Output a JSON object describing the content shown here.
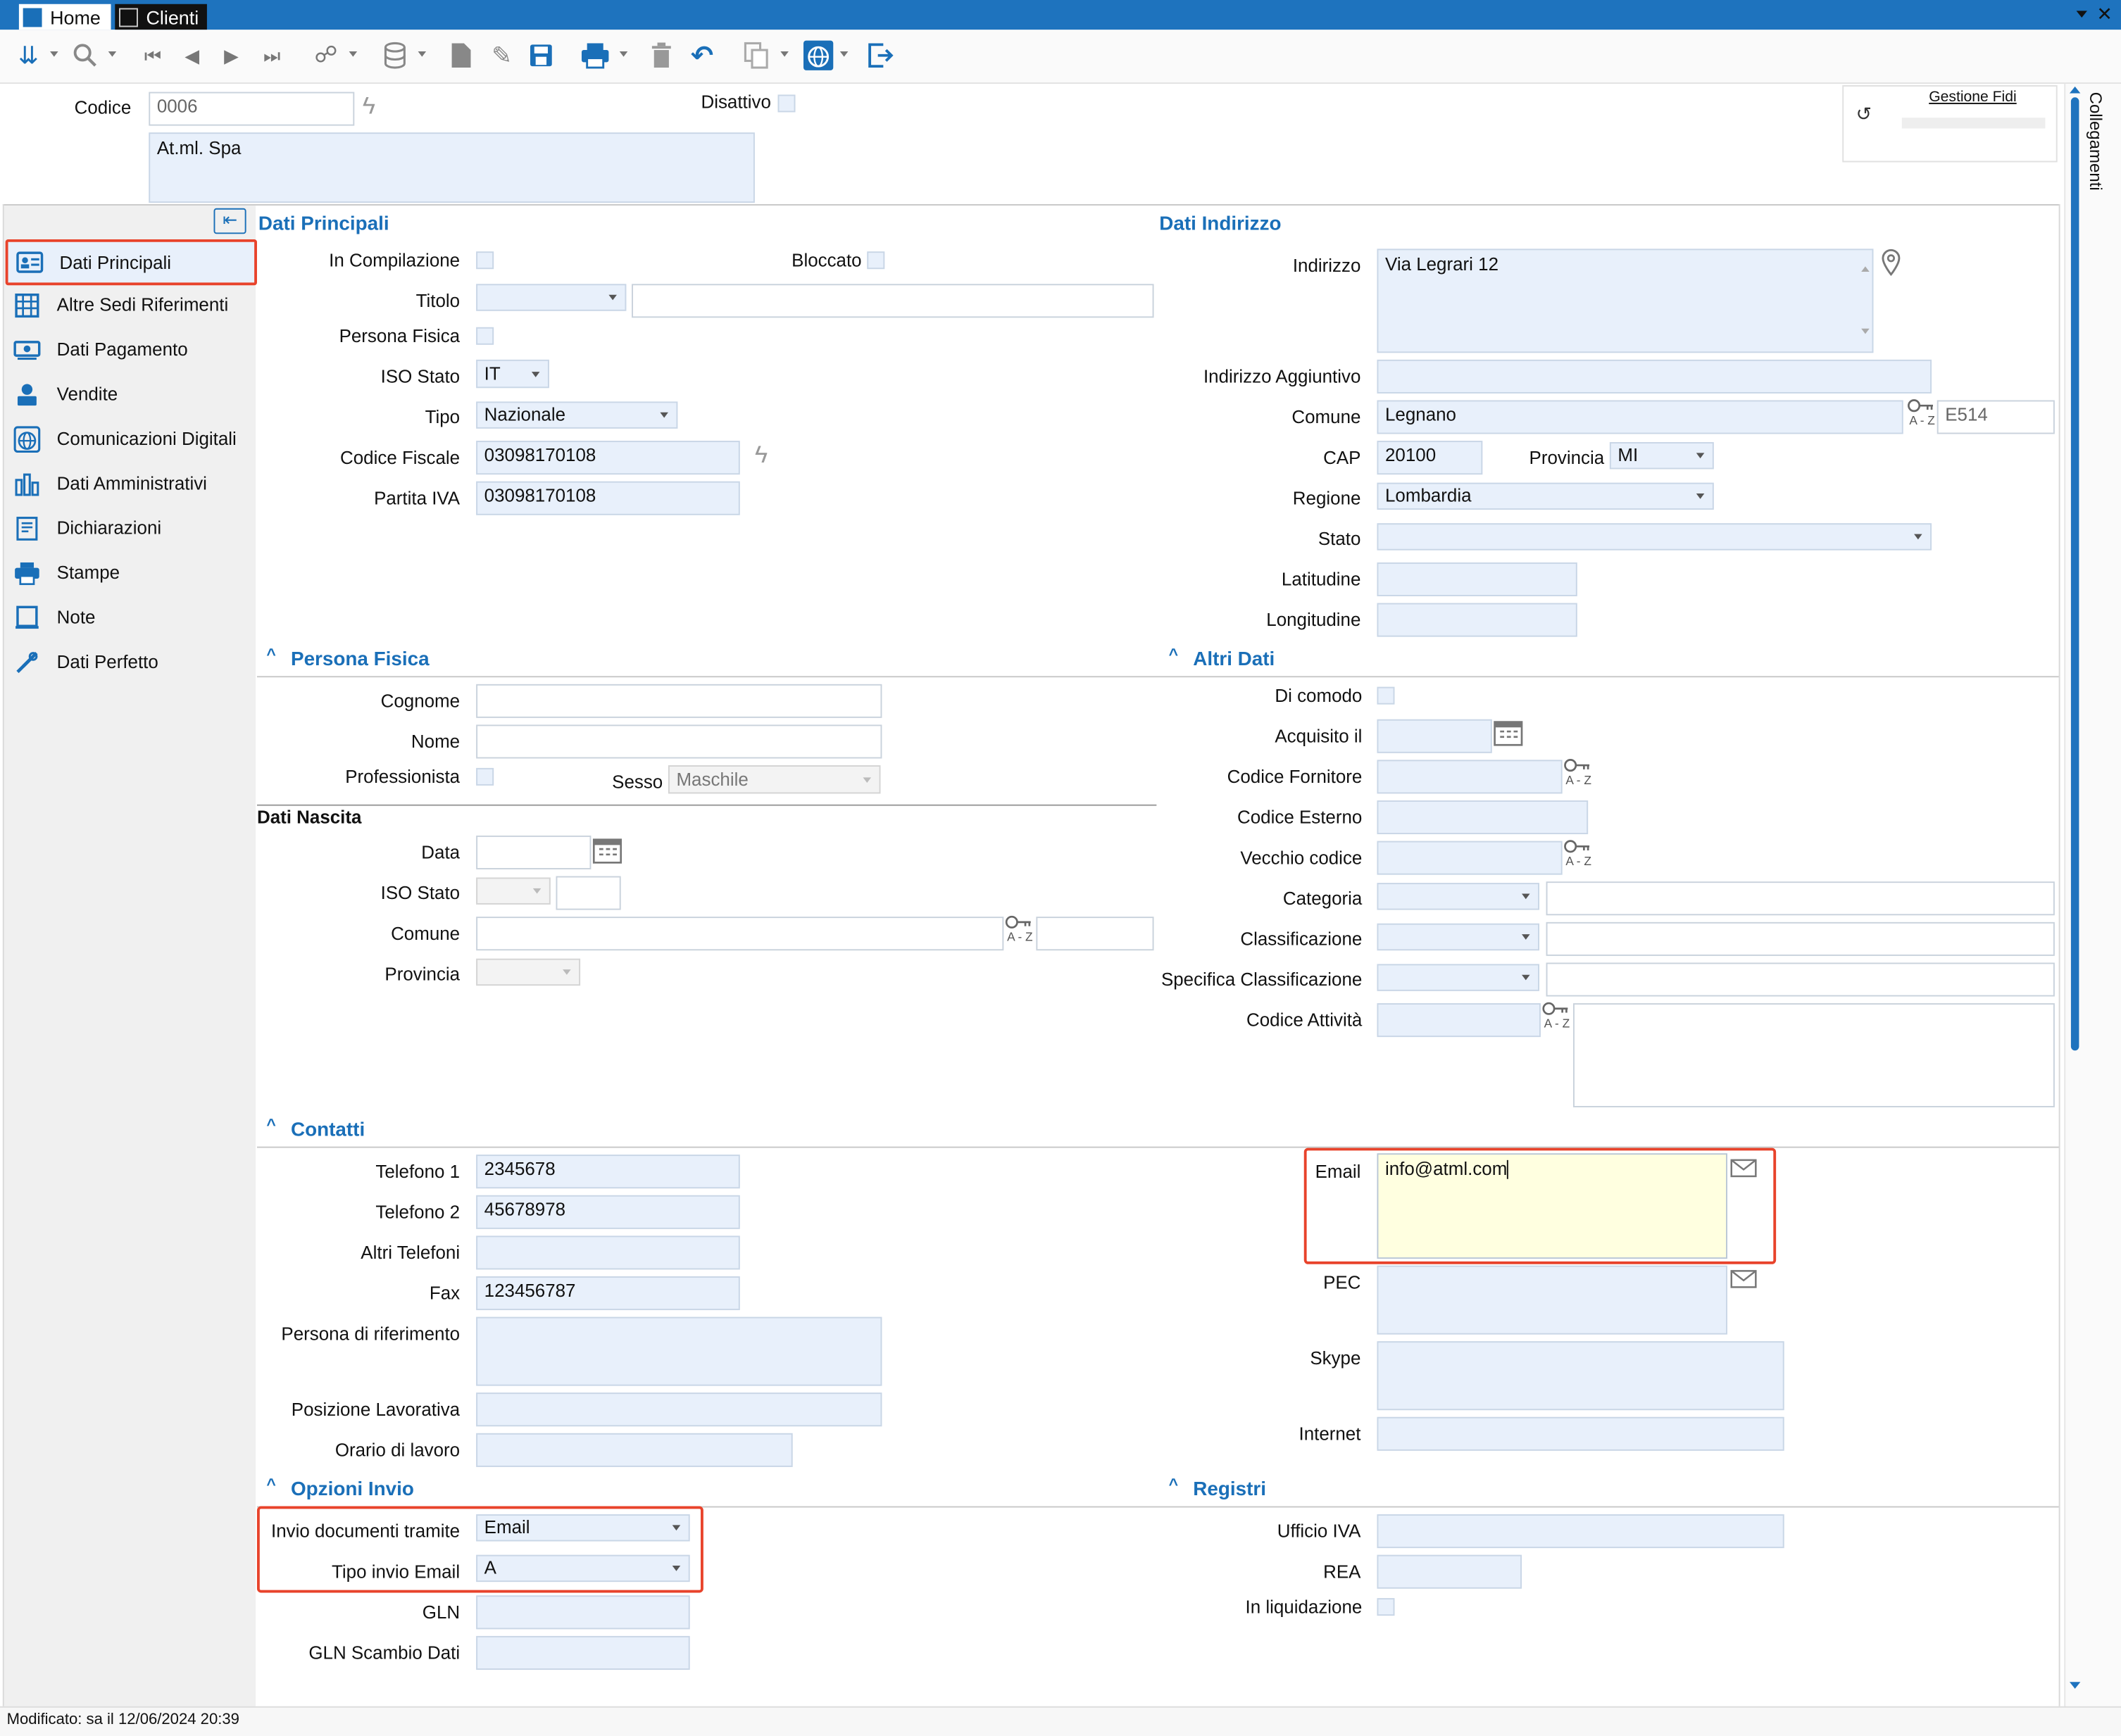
{
  "titlebar": {
    "tab_home": "Home",
    "tab_clienti": "Clienti"
  },
  "header": {
    "codice_label": "Codice",
    "codice_value": "0006",
    "ragione_sociale": "At.ml. Spa",
    "disattivo_label": "Disattivo",
    "gestione_fidi": "Gestione Fidi",
    "collegamenti": "Collegamenti"
  },
  "sidebar": {
    "items": [
      {
        "label": "Dati Principali",
        "icon": "card-icon"
      },
      {
        "label": "Altre Sedi Riferimenti",
        "icon": "building-icon"
      },
      {
        "label": "Dati Pagamento",
        "icon": "money-icon"
      },
      {
        "label": "Vendite",
        "icon": "cashier-icon"
      },
      {
        "label": "Comunicazioni Digitali",
        "icon": "globe-icon"
      },
      {
        "label": "Dati Amministrativi",
        "icon": "bar-chart-icon"
      },
      {
        "label": "Dichiarazioni",
        "icon": "document-icon"
      },
      {
        "label": "Stampe",
        "icon": "printer-icon"
      },
      {
        "label": "Note",
        "icon": "notepad-icon"
      },
      {
        "label": "Dati Perfetto",
        "icon": "tools-icon"
      }
    ]
  },
  "dati_principali": {
    "title": "Dati Principali",
    "in_compilazione": "In Compilazione",
    "bloccato": "Bloccato",
    "titolo": "Titolo",
    "persona_fisica": "Persona Fisica",
    "iso_stato": "ISO Stato",
    "iso_stato_value": "IT",
    "tipo": "Tipo",
    "tipo_value": "Nazionale",
    "codice_fiscale": "Codice Fiscale",
    "codice_fiscale_value": "03098170108",
    "partita_iva": "Partita IVA",
    "partita_iva_value": "03098170108"
  },
  "dati_indirizzo": {
    "title": "Dati Indirizzo",
    "indirizzo": "Indirizzo",
    "indirizzo_value": "Via Legrari 12",
    "indirizzo_aggiuntivo": "Indirizzo Aggiuntivo",
    "comune": "Comune",
    "comune_value": "Legnano",
    "comune_code": "E514",
    "cap": "CAP",
    "cap_value": "20100",
    "provincia": "Provincia",
    "provincia_value": "MI",
    "regione": "Regione",
    "regione_value": "Lombardia",
    "stato": "Stato",
    "latitudine": "Latitudine",
    "longitudine": "Longitudine"
  },
  "persona_fisica": {
    "title": "Persona Fisica",
    "cognome": "Cognome",
    "nome": "Nome",
    "professionista": "Professionista",
    "sesso": "Sesso",
    "sesso_value": "Maschile",
    "dati_nascita": "Dati Nascita",
    "data": "Data",
    "iso_stato": "ISO Stato",
    "comune": "Comune",
    "provincia": "Provincia"
  },
  "altri_dati": {
    "title": "Altri Dati",
    "di_comodo": "Di comodo",
    "acquisito_il": "Acquisito il",
    "codice_fornitore": "Codice Fornitore",
    "codice_esterno": "Codice Esterno",
    "vecchio_codice": "Vecchio codice",
    "categoria": "Categoria",
    "classificazione": "Classificazione",
    "specifica_classificazione": "Specifica Classificazione",
    "codice_attivita": "Codice Attività"
  },
  "contatti": {
    "title": "Contatti",
    "telefono1": "Telefono 1",
    "telefono1_value": "2345678",
    "telefono2": "Telefono 2",
    "telefono2_value": "45678978",
    "altri_telefoni": "Altri Telefoni",
    "fax": "Fax",
    "fax_value": "123456787",
    "persona_riferimento": "Persona di riferimento",
    "posizione_lavorativa": "Posizione Lavorativa",
    "orario_lavoro": "Orario di lavoro",
    "email": "Email",
    "email_value": "info@atml.com",
    "pec": "PEC",
    "skype": "Skype",
    "internet": "Internet"
  },
  "opzioni_invio": {
    "title": "Opzioni Invio",
    "invio_documenti": "Invio documenti tramite",
    "invio_documenti_value": "Email",
    "tipo_invio_email": "Tipo invio Email",
    "tipo_invio_email_value": "A",
    "gln": "GLN",
    "gln_scambio": "GLN Scambio Dati"
  },
  "registri": {
    "title": "Registri",
    "ufficio_iva": "Ufficio IVA",
    "rea": "REA",
    "in_liquidazione": "In liquidazione"
  },
  "az_label": "A - Z",
  "statusbar": {
    "text": "Modificato: sa il 12/06/2024 20:39"
  },
  "colors": {
    "accent": "#1a6fb8",
    "highlight_red": "#e8432b",
    "field_bg": "#e8f0fb",
    "title_bar": "#1e73be"
  }
}
